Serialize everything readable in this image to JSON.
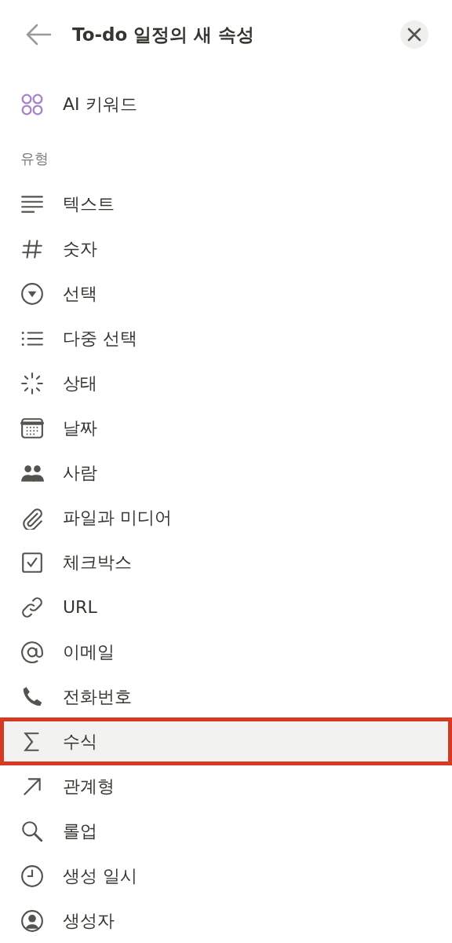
{
  "header": {
    "title": "To-do 일정의 새 속성"
  },
  "ai_items": [
    {
      "kind": "ai_keywords",
      "label": "AI 키워드",
      "selected": false,
      "annotated": false
    }
  ],
  "section_label": "유형",
  "items": [
    {
      "kind": "text",
      "label": "텍스트",
      "selected": false,
      "annotated": false
    },
    {
      "kind": "number",
      "label": "숫자",
      "selected": false,
      "annotated": false
    },
    {
      "kind": "select",
      "label": "선택",
      "selected": false,
      "annotated": false
    },
    {
      "kind": "multi_select",
      "label": "다중 선택",
      "selected": false,
      "annotated": false
    },
    {
      "kind": "status",
      "label": "상태",
      "selected": false,
      "annotated": false
    },
    {
      "kind": "date",
      "label": "날짜",
      "selected": false,
      "annotated": false
    },
    {
      "kind": "person",
      "label": "사람",
      "selected": false,
      "annotated": false
    },
    {
      "kind": "files",
      "label": "파일과 미디어",
      "selected": false,
      "annotated": false
    },
    {
      "kind": "checkbox",
      "label": "체크박스",
      "selected": false,
      "annotated": false
    },
    {
      "kind": "url",
      "label": "URL",
      "selected": false,
      "annotated": false
    },
    {
      "kind": "email",
      "label": "이메일",
      "selected": false,
      "annotated": false
    },
    {
      "kind": "phone",
      "label": "전화번호",
      "selected": false,
      "annotated": false
    },
    {
      "kind": "formula",
      "label": "수식",
      "selected": true,
      "annotated": true
    },
    {
      "kind": "relation",
      "label": "관계형",
      "selected": false,
      "annotated": false
    },
    {
      "kind": "rollup",
      "label": "롤업",
      "selected": false,
      "annotated": false
    },
    {
      "kind": "created_time",
      "label": "생성 일시",
      "selected": false,
      "annotated": false
    },
    {
      "kind": "created_by",
      "label": "생성자",
      "selected": false,
      "annotated": false
    }
  ]
}
